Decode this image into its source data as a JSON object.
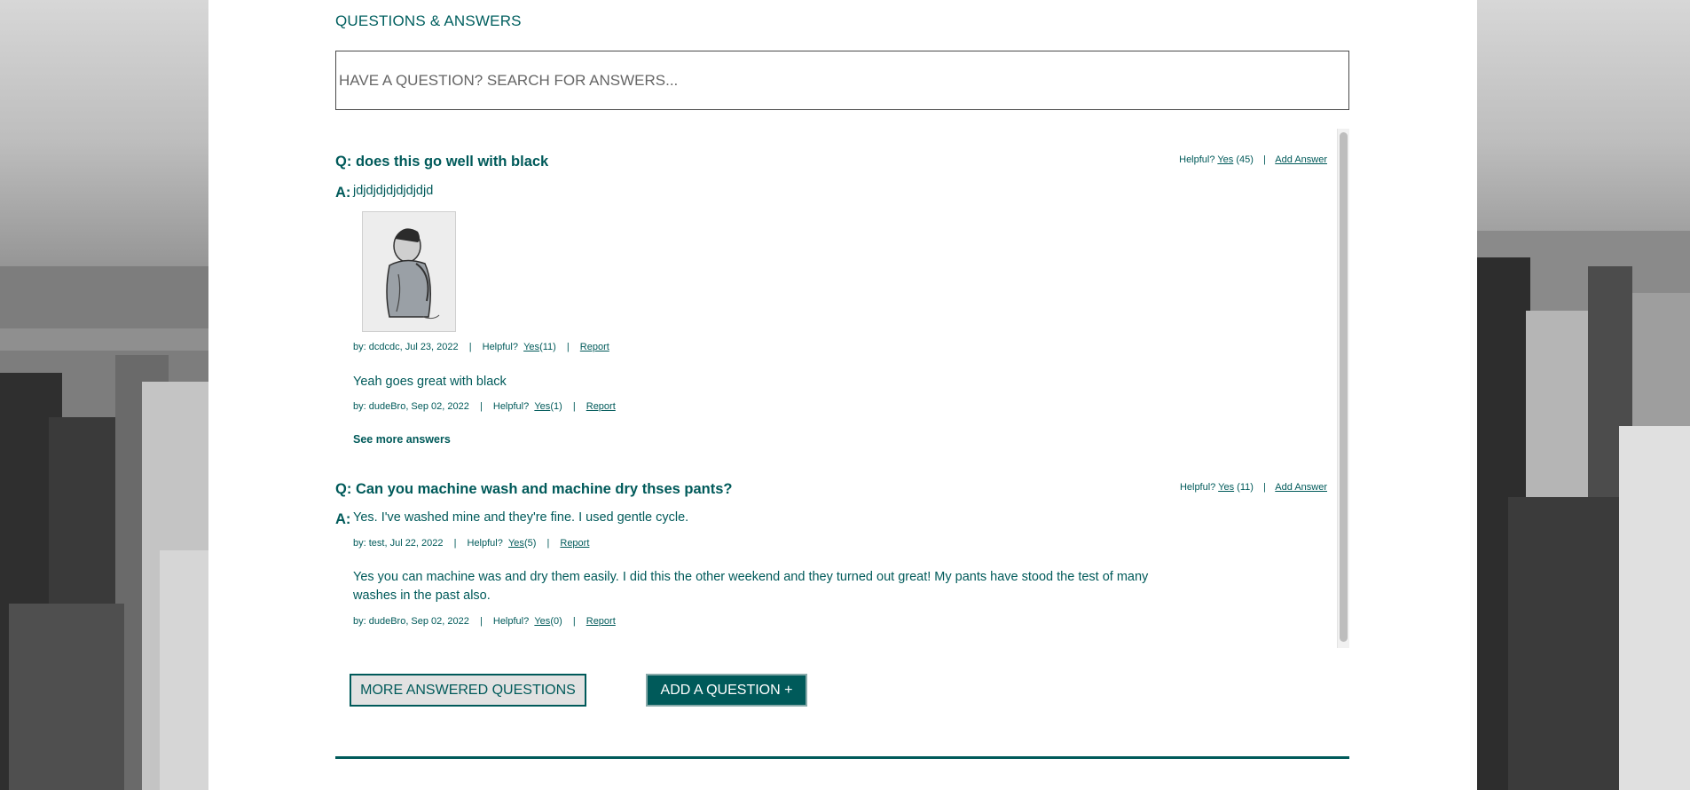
{
  "section": {
    "title": "QUESTIONS & ANSWERS"
  },
  "search": {
    "placeholder": "HAVE A QUESTION? SEARCH FOR ANSWERS..."
  },
  "questions": [
    {
      "prefix": "Q:",
      "text": "does this go well with black",
      "helpful_label": "Helpful?",
      "yes_label": "Yes",
      "yes_count": "(45)",
      "separator": "|",
      "add_answer_label": "Add Answer",
      "answers": [
        {
          "prefix": "A:",
          "body": "jdjdjdjdjdjdjdjd",
          "photo_icon": "answer-photo",
          "by": "by: dcdcdc, Jul 23, 2022",
          "helpful_label": "Helpful?",
          "yes_label": "Yes",
          "yes_count": "(11)",
          "report_label": "Report"
        },
        {
          "body": "Yeah goes great with black",
          "by": "by: dudeBro, Sep 02, 2022",
          "helpful_label": "Helpful?",
          "yes_label": "Yes",
          "yes_count": "(1)",
          "report_label": "Report"
        }
      ],
      "see_more_label": "See more answers"
    },
    {
      "prefix": "Q:",
      "text": "Can you machine wash and machine dry thses pants?",
      "helpful_label": "Helpful?",
      "yes_label": "Yes",
      "yes_count": "(11)",
      "separator": "|",
      "add_answer_label": "Add Answer",
      "answers": [
        {
          "prefix": "A:",
          "body": "Yes. I've washed mine and they're fine. I used gentle cycle.",
          "by": "by: test, Jul 22, 2022",
          "helpful_label": "Helpful?",
          "yes_label": "Yes",
          "yes_count": "(5)",
          "report_label": "Report"
        },
        {
          "body": "Yes you can machine was and dry them easily. I did this the other weekend and they turned out great! My pants have stood the test of many washes in the past also.",
          "by": "by: dudeBro, Sep 02, 2022",
          "helpful_label": "Helpful?",
          "yes_label": "Yes",
          "yes_count": "(0)",
          "report_label": "Report"
        }
      ]
    }
  ],
  "buttons": {
    "more_questions": "MORE ANSWERED QUESTIONS",
    "add_question": "ADD A QUESTION +"
  },
  "colors": {
    "accent": "#005a5a",
    "panel": "#ffffff"
  }
}
